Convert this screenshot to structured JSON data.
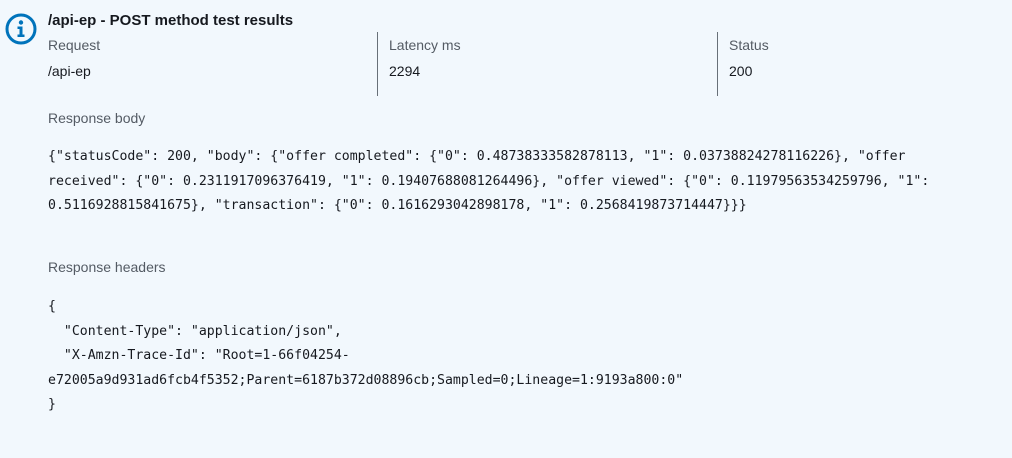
{
  "alert": {
    "icon": "info-icon",
    "accent_color": "#0073bb",
    "title": "/api-ep - POST method test results"
  },
  "summary": {
    "request_label": "Request",
    "request_value": "/api-ep",
    "latency_label": "Latency ms",
    "latency_value": "2294",
    "status_label": "Status",
    "status_value": "200"
  },
  "response_body": {
    "label": "Response body",
    "lines": [
      "{\"statusCode\": 200, \"body\": {\"offer completed\": {\"0\": 0.48738333582878113, \"1\": 0.03738824278116226}, \"offer",
      "received\": {\"0\": 0.2311917096376419, \"1\": 0.19407688081264496}, \"offer viewed\": {\"0\": 0.11979563534259796, \"1\":",
      "0.5116928815841675}, \"transaction\": {\"0\": 0.1616293042898178, \"1\": 0.2568419873714447}}}"
    ]
  },
  "response_headers": {
    "label": "Response headers",
    "lines": [
      "{",
      "  \"Content-Type\": \"application/json\",",
      "  \"X-Amzn-Trace-Id\": \"Root=1-66f04254-",
      "e72005a9d931ad6fcb4f5352;Parent=6187b372d08896cb;Sampled=0;Lineage=1:9193a800:0\"",
      "}"
    ]
  }
}
